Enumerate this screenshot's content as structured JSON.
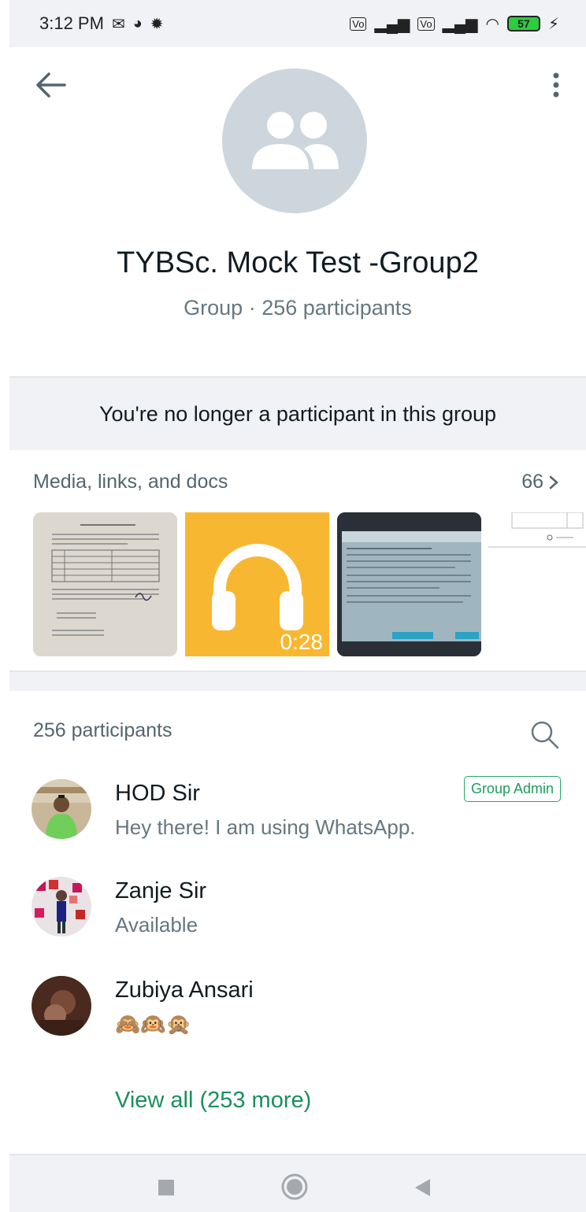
{
  "status_bar": {
    "time": "3:12 PM",
    "battery": "57",
    "icons": [
      "mail-icon",
      "data-saver-icon",
      "settings-icon",
      "volte-icon",
      "signal-icon",
      "wifi-icon",
      "charging-icon"
    ]
  },
  "header": {
    "group_name": "TYBSc. Mock Test -Group2",
    "subtitle": "Group · 256 participants"
  },
  "notice": {
    "text": "You're no longer a participant in this group"
  },
  "media": {
    "title": "Media, links, and docs",
    "count": "66",
    "audio_duration": "0:28"
  },
  "participants": {
    "title": "256 participants",
    "list": [
      {
        "name": "HOD Sir",
        "status": "Hey there! I am using WhatsApp.",
        "badge": "Group Admin"
      },
      {
        "name": "Zanje Sir",
        "status": "Available",
        "badge": ""
      },
      {
        "name": "Zubiya Ansari",
        "status": "🙈🙉🙊",
        "badge": ""
      }
    ],
    "view_all": "View all (253 more)"
  },
  "colors": {
    "accent_green": "#1a8f5c",
    "secondary_text": "#667781",
    "section_bg": "#f0f2f5",
    "audio_thumb": "#f8b731"
  }
}
